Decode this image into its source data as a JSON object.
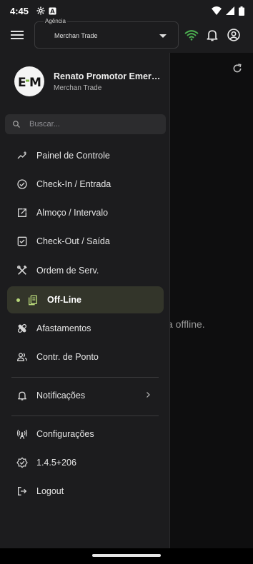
{
  "status_bar": {
    "time": "4:45"
  },
  "app_bar": {
    "agency_label": "Agência",
    "agency_value": "Merchan Trade",
    "wifi_color": "#4caf50"
  },
  "drawer": {
    "user_name": "Renato Promotor Emerc...",
    "user_company": "Merchan Trade",
    "search_placeholder": "Buscar...",
    "items": [
      {
        "label": "Painel de Controle",
        "icon": "dashboard-sparkle-icon"
      },
      {
        "label": "Check-In / Entrada",
        "icon": "check-circle-icon"
      },
      {
        "label": "Almoço / Intervalo",
        "icon": "open-external-icon"
      },
      {
        "label": "Check-Out / Saída",
        "icon": "checkbox-icon"
      },
      {
        "label": "Ordem de Serv.",
        "icon": "tools-icon"
      },
      {
        "label": "Off-Line",
        "icon": "offline-device-icon",
        "active": true
      },
      {
        "label": "Afastamentos",
        "icon": "bandage-icon"
      },
      {
        "label": "Contr. de Ponto",
        "icon": "people-icon"
      }
    ],
    "notifications_label": "Notificações",
    "settings_label": "Configurações",
    "version_label": "1.4.5+206",
    "logout_label": "Logout",
    "accent_color": "#b7d77a"
  },
  "background": {
    "partial_text": "a offline."
  }
}
